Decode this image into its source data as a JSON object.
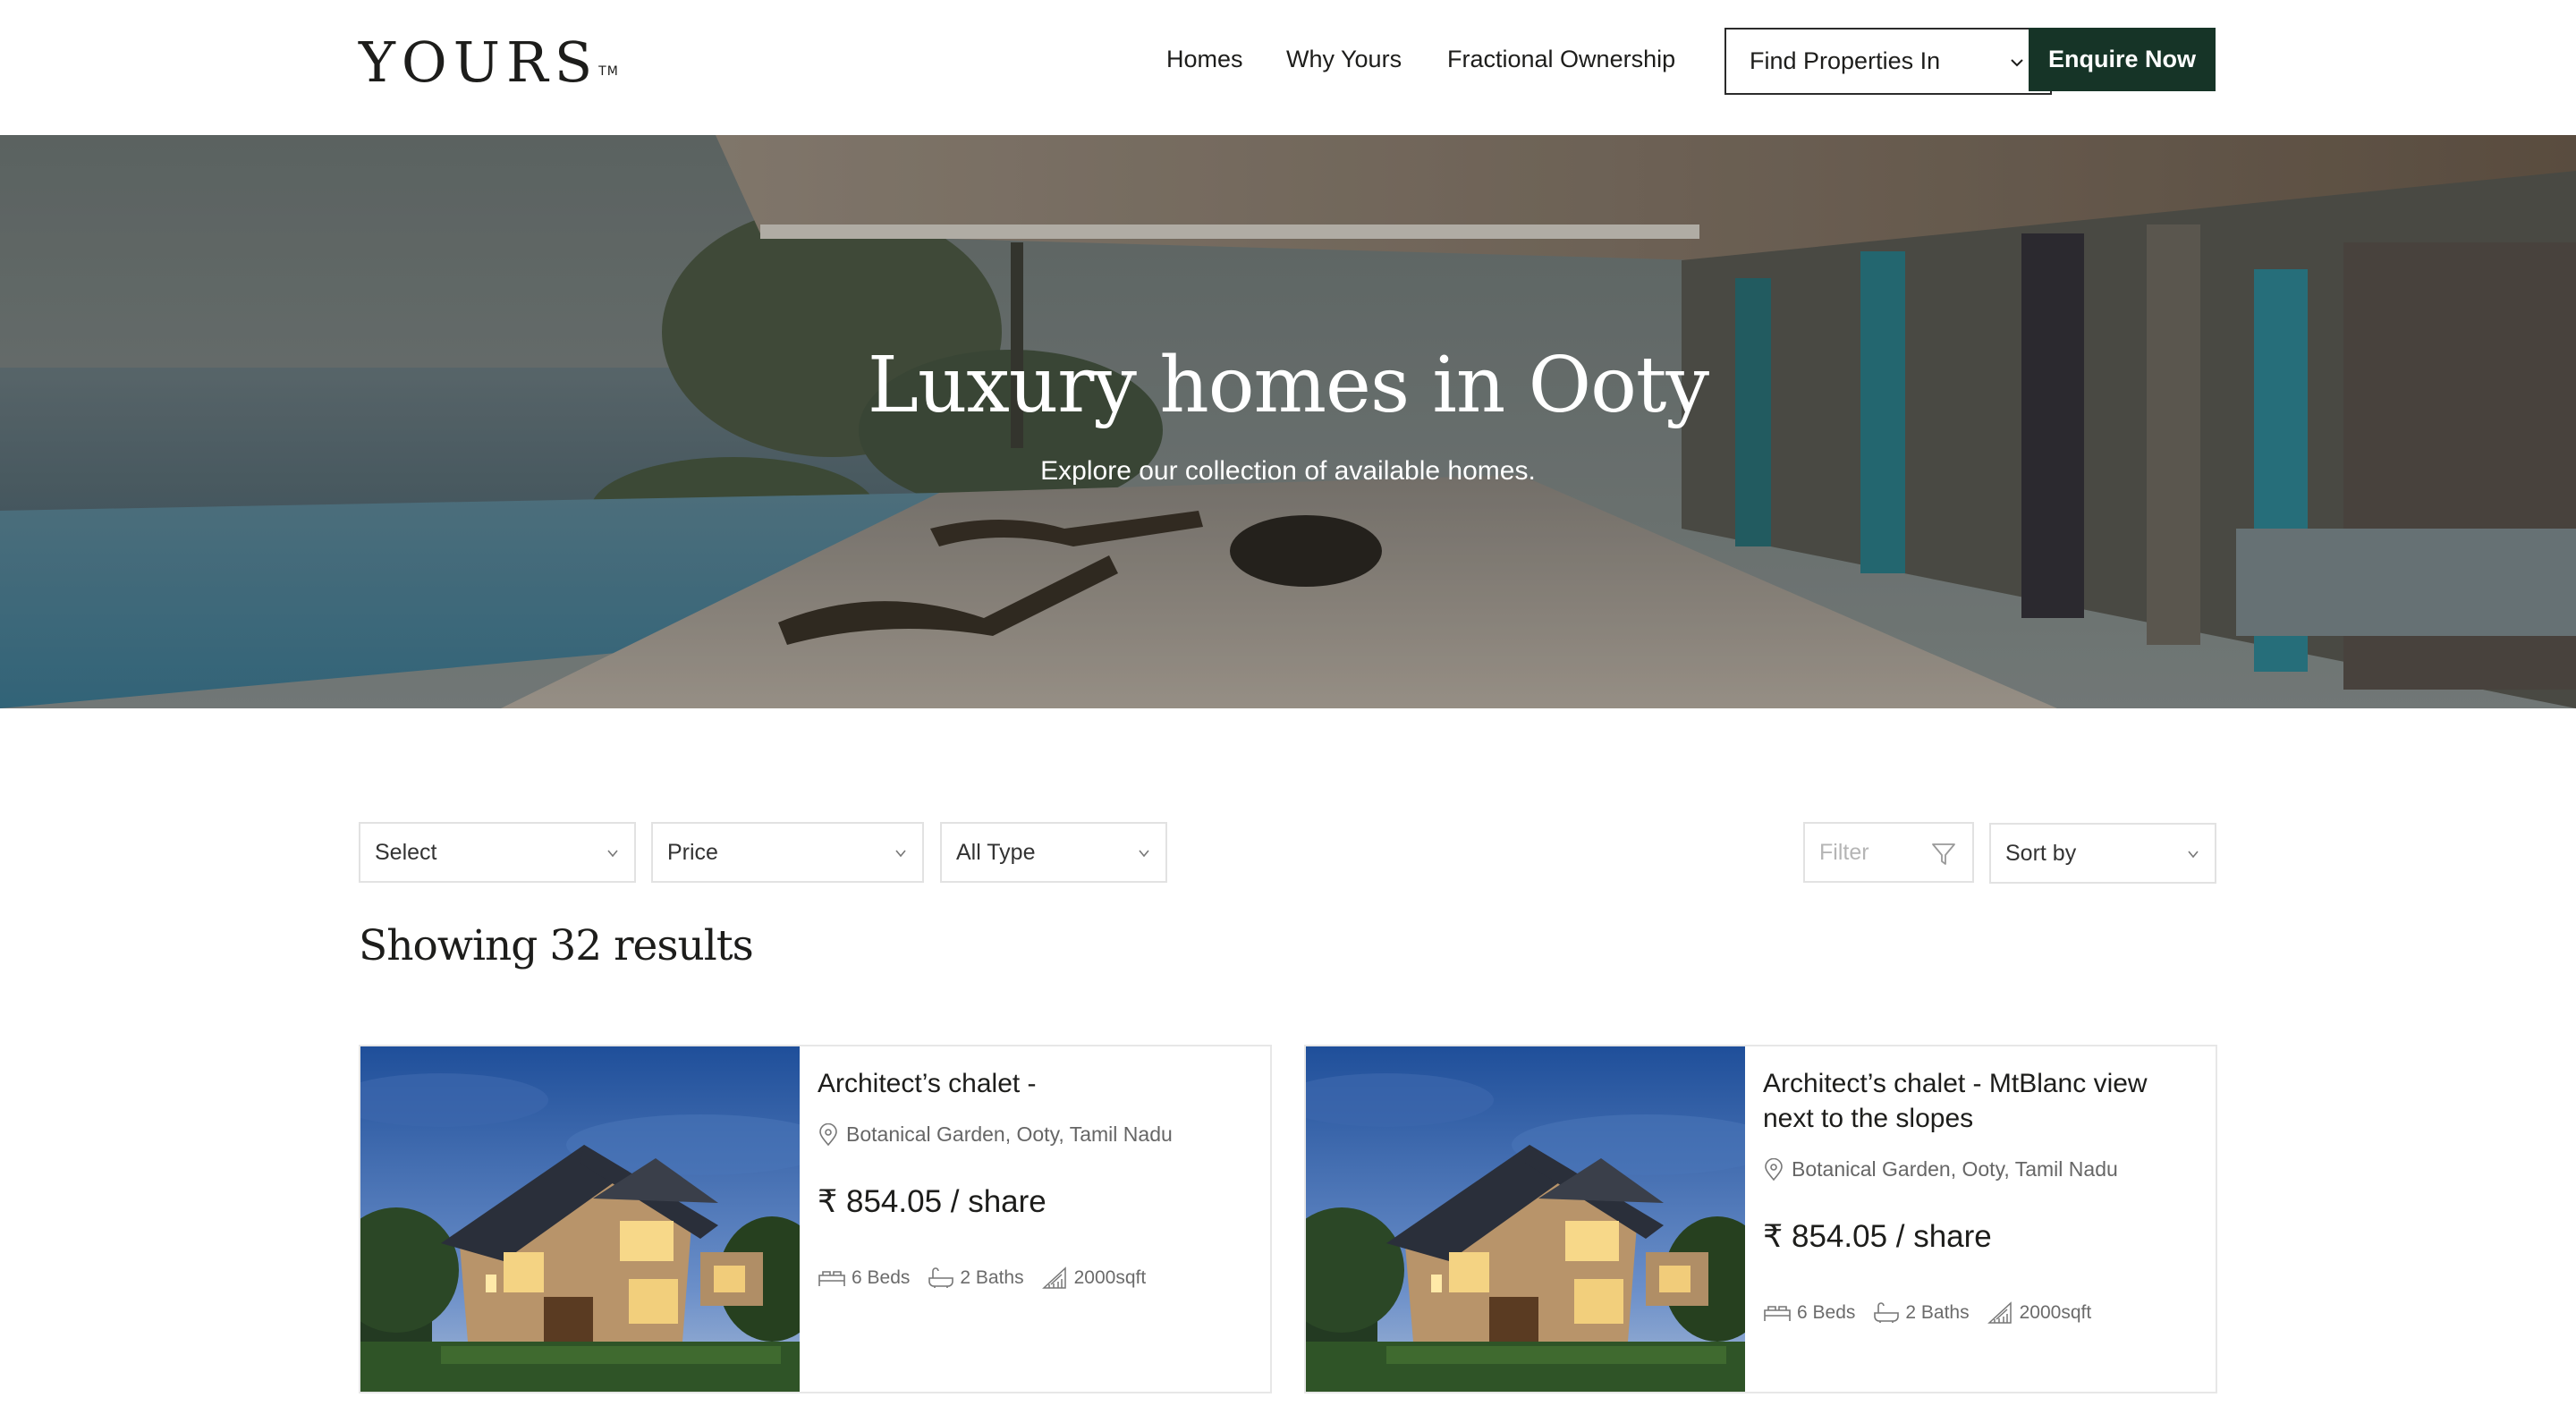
{
  "header": {
    "logo": "YOURS",
    "logo_mark": "TM",
    "nav": [
      "Homes",
      "Why Yours",
      "Fractional Ownership"
    ],
    "find_properties": "Find Properties In",
    "enquire": "Enquire Now"
  },
  "hero": {
    "title": "Luxury homes in Ooty",
    "subtitle": "Explore our collection of available homes."
  },
  "filters": {
    "location": "Select",
    "price": "Price",
    "type": "All Type",
    "filter": "Filter",
    "sort": "Sort by"
  },
  "results_text": "Showing 32 results",
  "listings": [
    {
      "title": "Architect’s chalet -",
      "location": "Botanical Garden, Ooty, Tamil Nadu",
      "price": "₹ 854.05 / share",
      "beds": "6 Beds",
      "baths": "2 Baths",
      "area": "2000sqft"
    },
    {
      "title": "Architect’s chalet - MtBlanc view next to the slopes",
      "location": "Botanical Garden, Ooty, Tamil Nadu",
      "price": "₹ 854.05 / share",
      "beds": "6 Beds",
      "baths": "2 Baths",
      "area": "2000sqft"
    }
  ],
  "colors": {
    "brand_dark": "#163427",
    "text": "#1d1d1b",
    "border": "#e2e2e2"
  }
}
